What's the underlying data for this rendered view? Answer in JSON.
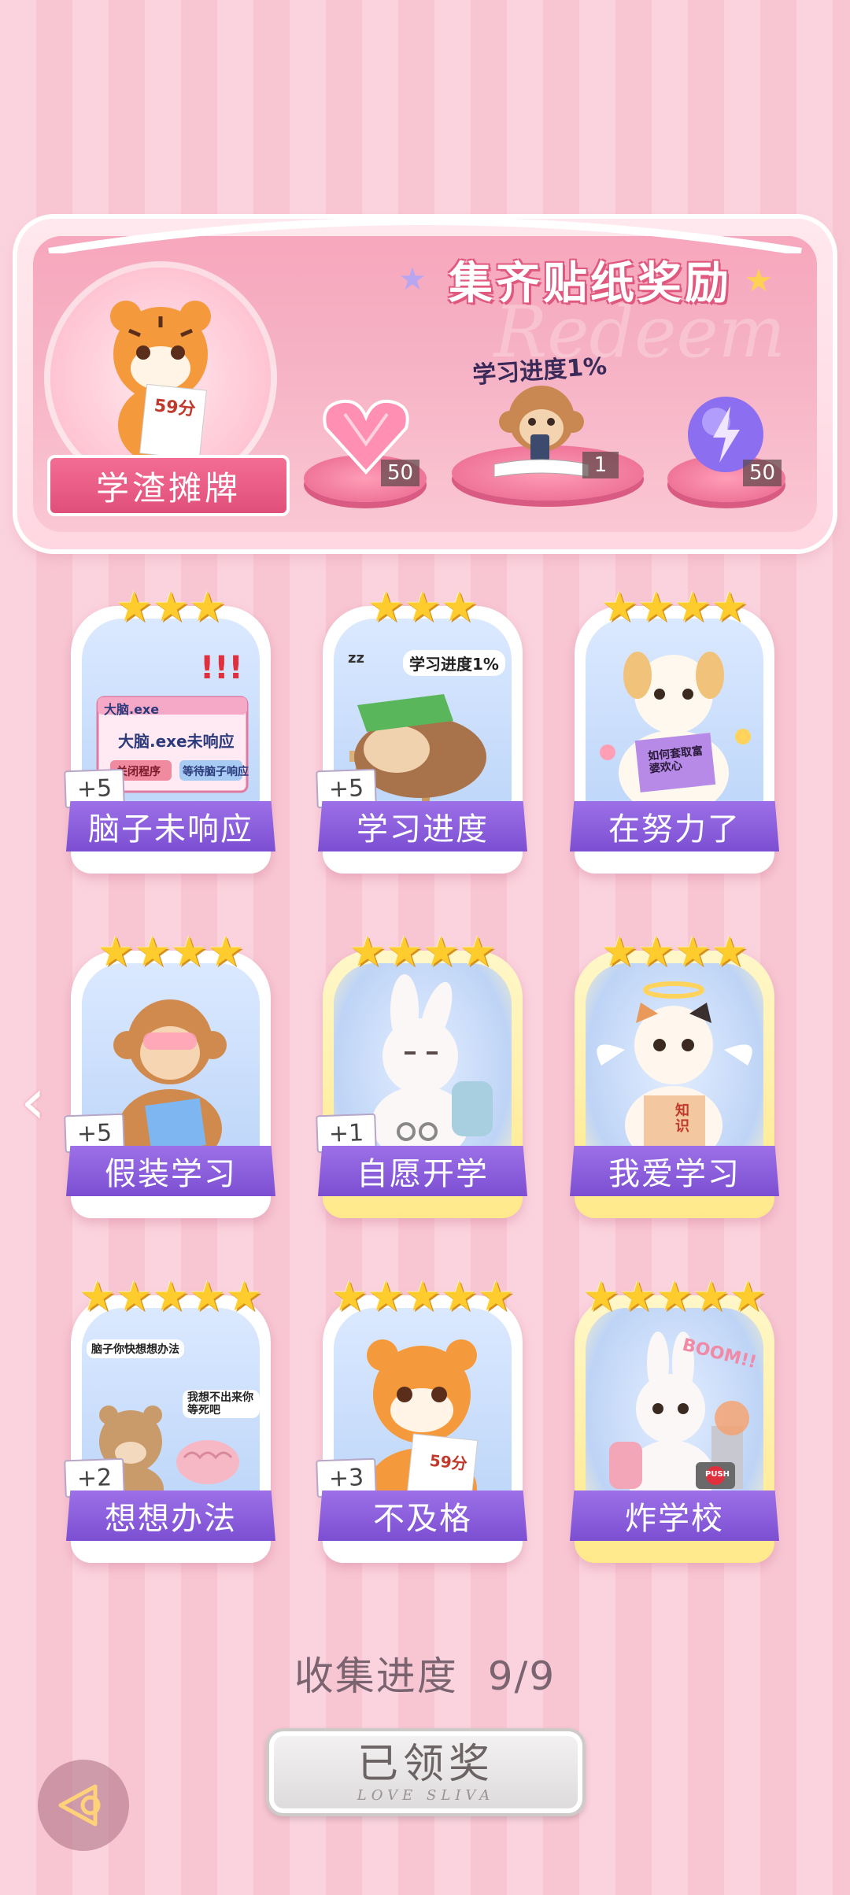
{
  "banner": {
    "title": "集齐贴纸奖励",
    "watermark": "Redeem",
    "nameplate": "学渣摊牌",
    "tiger_paper": "59分",
    "progress_tag": "学习进度1%",
    "rewards": [
      {
        "icon": "pink-heart-gem-icon",
        "count": "50"
      },
      {
        "icon": "monkey-study-sticker-icon",
        "count": "1"
      },
      {
        "icon": "lightning-orb-icon",
        "count": "50"
      }
    ]
  },
  "cards": [
    {
      "label": "脑子未响应",
      "stars": 3,
      "gold": false,
      "bonus": "+5",
      "art": {
        "window_title": "大脑.exe",
        "message": "大脑.exe未响应",
        "btn1": "关闭程序",
        "btn2": "等待脑子响应",
        "exclaim": "!!!"
      }
    },
    {
      "label": "学习进度",
      "stars": 3,
      "gold": false,
      "bonus": "+5",
      "art": {
        "bubble": "学习进度1%",
        "zzz": "zz"
      }
    },
    {
      "label": "在努力了",
      "stars": 4,
      "gold": false,
      "bonus": "",
      "art": {
        "book": "如何套取富婆欢心"
      }
    },
    {
      "label": "假装学习",
      "stars": 4,
      "gold": false,
      "bonus": "+5",
      "art": {}
    },
    {
      "label": "自愿开学",
      "stars": 4,
      "gold": true,
      "bonus": "+1",
      "art": {}
    },
    {
      "label": "我爱学习",
      "stars": 4,
      "gold": true,
      "bonus": "",
      "art": {
        "book": "知识"
      }
    },
    {
      "label": "想想办法",
      "stars": 5,
      "gold": false,
      "bonus": "+2",
      "art": {
        "bubble1": "脑子你快想想办法",
        "bubble2": "我想不出来你等死吧"
      }
    },
    {
      "label": "不及格",
      "stars": 5,
      "gold": false,
      "bonus": "+3",
      "art": {
        "paper": "59分"
      }
    },
    {
      "label": "炸学校",
      "stars": 5,
      "gold": true,
      "bonus": "",
      "art": {
        "boom": "BOOM!!",
        "push": "PUSH"
      }
    }
  ],
  "collect": {
    "label": "收集进度",
    "value": "9/9"
  },
  "claim_button": {
    "label": "已领奖",
    "sub": "LOVE SLIVA"
  },
  "colors": {
    "label_purple": "#8a5cdc",
    "banner_pink": "#f7a7bd",
    "star_gold": "#ffcc2e"
  }
}
